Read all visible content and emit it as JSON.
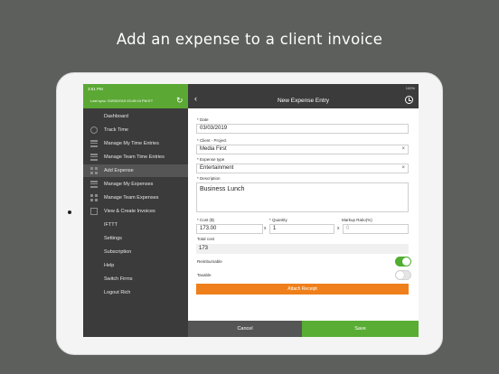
{
  "headline": "Add an expense to a client invoice",
  "sidebar": {
    "status_time": "3:51 PM",
    "last_sync": "Last sync: 03/03/2019 03:49:04 PM ET",
    "items": [
      {
        "label": "Dashboard",
        "icon": "none"
      },
      {
        "label": "Track Time",
        "icon": "clock-icon"
      },
      {
        "label": "Manage My Time Entries",
        "icon": "list-icon"
      },
      {
        "label": "Manage Team Time Entries",
        "icon": "list-icon"
      },
      {
        "label": "Add Expense",
        "icon": "grid-icon",
        "active": true
      },
      {
        "label": "Manage My Expenses",
        "icon": "list-icon"
      },
      {
        "label": "Manage Team Expenses",
        "icon": "grid-icon"
      },
      {
        "label": "View & Create Invoices",
        "icon": "invoice-icon"
      },
      {
        "label": "IFTTT",
        "icon": "none"
      },
      {
        "label": "Settings",
        "icon": "none"
      },
      {
        "label": "Subscription",
        "icon": "none"
      },
      {
        "label": "Help",
        "icon": "none"
      },
      {
        "label": "Switch Firms",
        "icon": "none"
      },
      {
        "label": "Logout Rich",
        "icon": "none"
      }
    ]
  },
  "nav": {
    "status_right": "100%",
    "title": "New Expense Entry"
  },
  "form": {
    "date_label": "* Date",
    "date_value": "03/03/2019",
    "client_label": "* Client - Project",
    "client_value": "Media First",
    "clear_glyph": "×",
    "type_label": "* Expense type",
    "type_value": "Entertainment",
    "desc_label": "* Description",
    "desc_value": "Business Lunch",
    "cost_label": "* Cost ($)",
    "cost_value": "173.00",
    "qty_label": "* Quantity",
    "qty_value": "1",
    "markup_label": "Markup Ratio(%)",
    "markup_placeholder": "0",
    "times": "x",
    "total_label": "Total cost",
    "total_value": "173",
    "reimbursable_label": "Reimbursable",
    "reimbursable_on": true,
    "taxable_label": "Taxable",
    "taxable_on": false,
    "attach_label": "Attach Receipt"
  },
  "actions": {
    "cancel": "Cancel",
    "save": "Save"
  },
  "colors": {
    "brand_green": "#5ba834",
    "sidebar_bg": "#3b3b3b",
    "attach_orange": "#ef7f1a",
    "page_bg": "#5d5f5c"
  }
}
